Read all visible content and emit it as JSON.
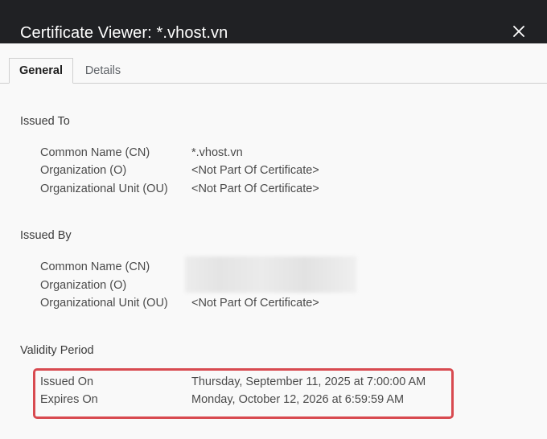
{
  "window": {
    "title": "Certificate Viewer: *.vhost.vn",
    "close_icon": "close-icon"
  },
  "tabs": [
    {
      "label": "General",
      "selected": true
    },
    {
      "label": "Details",
      "selected": false
    }
  ],
  "issued_to": {
    "title": "Issued To",
    "rows": [
      {
        "label": "Common Name (CN)",
        "value": "*.vhost.vn"
      },
      {
        "label": "Organization (O)",
        "value": "<Not Part Of Certificate>"
      },
      {
        "label": "Organizational Unit (OU)",
        "value": "<Not Part Of Certificate>"
      }
    ]
  },
  "issued_by": {
    "title": "Issued By",
    "rows": [
      {
        "label": "Common Name (CN)",
        "value": ""
      },
      {
        "label": "Organization (O)",
        "value": ""
      },
      {
        "label": "Organizational Unit (OU)",
        "value": "<Not Part Of Certificate>"
      }
    ]
  },
  "validity": {
    "title": "Validity Period",
    "rows": [
      {
        "label": "Issued On",
        "value": "Thursday, September 11, 2025 at 7:00:00 AM"
      },
      {
        "label": "Expires On",
        "value": "Monday, October 12, 2026 at 6:59:59 AM"
      }
    ]
  },
  "colors": {
    "titlebar": "#202124",
    "highlight": "#d84a50",
    "background": "#f9f9f9"
  }
}
